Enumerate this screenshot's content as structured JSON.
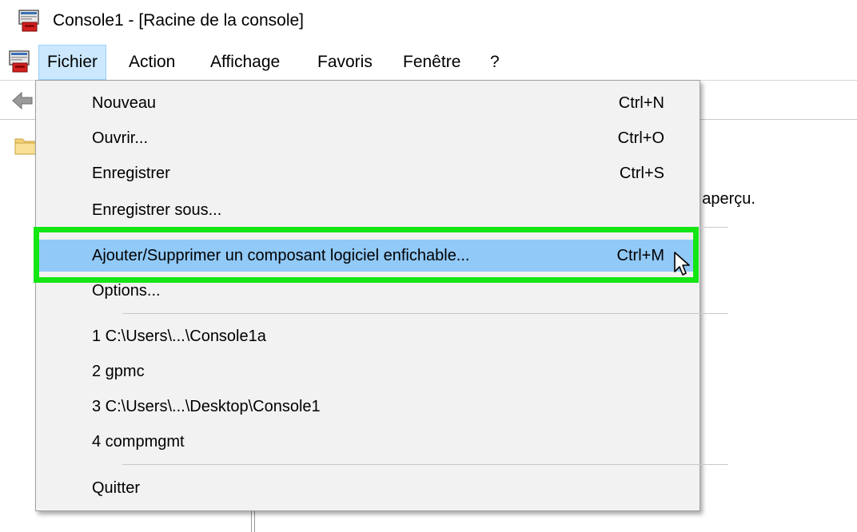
{
  "window": {
    "title": "Console1 - [Racine de la console]",
    "app_icon": "mmc-icon"
  },
  "menubar": {
    "items": [
      {
        "label": "Fichier",
        "active": true
      },
      {
        "label": "Action"
      },
      {
        "label": "Affichage"
      },
      {
        "label": "Favoris"
      },
      {
        "label": "Fenêtre"
      },
      {
        "label": "?"
      }
    ]
  },
  "toolbar": {
    "back_icon": "back-arrow-icon"
  },
  "tree": {
    "root_icon": "folder-icon"
  },
  "right_pane": {
    "partial_text": "et aperçu."
  },
  "file_menu": {
    "items": [
      {
        "label": "Nouveau",
        "shortcut": "Ctrl+N"
      },
      {
        "label": "Ouvrir...",
        "shortcut": "Ctrl+O"
      },
      {
        "label": "Enregistrer",
        "shortcut": "Ctrl+S"
      },
      {
        "label": "Enregistrer sous...",
        "shortcut": ""
      },
      {
        "label": "Ajouter/Supprimer un composant logiciel enfichable...",
        "shortcut": "Ctrl+M",
        "highlighted": true
      },
      {
        "label": "Options...",
        "shortcut": ""
      },
      {
        "label": "1 C:\\Users\\...\\Console1a",
        "shortcut": ""
      },
      {
        "label": "2 gpmc",
        "shortcut": ""
      },
      {
        "label": "3 C:\\Users\\...\\Desktop\\Console1",
        "shortcut": ""
      },
      {
        "label": "4 compmgmt",
        "shortcut": ""
      },
      {
        "label": "Quitter",
        "shortcut": ""
      }
    ]
  },
  "colors": {
    "highlight_fill": "#91c9f7",
    "annotation_border": "#14e614",
    "menu_background": "#f2f2f2",
    "active_menu_background": "#cce8ff"
  }
}
